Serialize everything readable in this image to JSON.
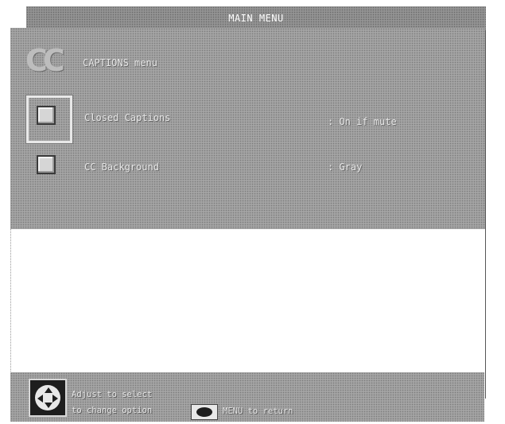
{
  "window": {
    "title": "MAIN MENU"
  },
  "panel": {
    "logo": "CC",
    "heading": "CAPTIONS menu",
    "items": [
      {
        "label": "Closed Captions",
        "value": ": On if mute"
      },
      {
        "label": "CC Background",
        "value": ": Gray"
      }
    ]
  },
  "footer": {
    "line1": "Adjust to select",
    "line2": "to change option",
    "line3": "MENU to return"
  }
}
